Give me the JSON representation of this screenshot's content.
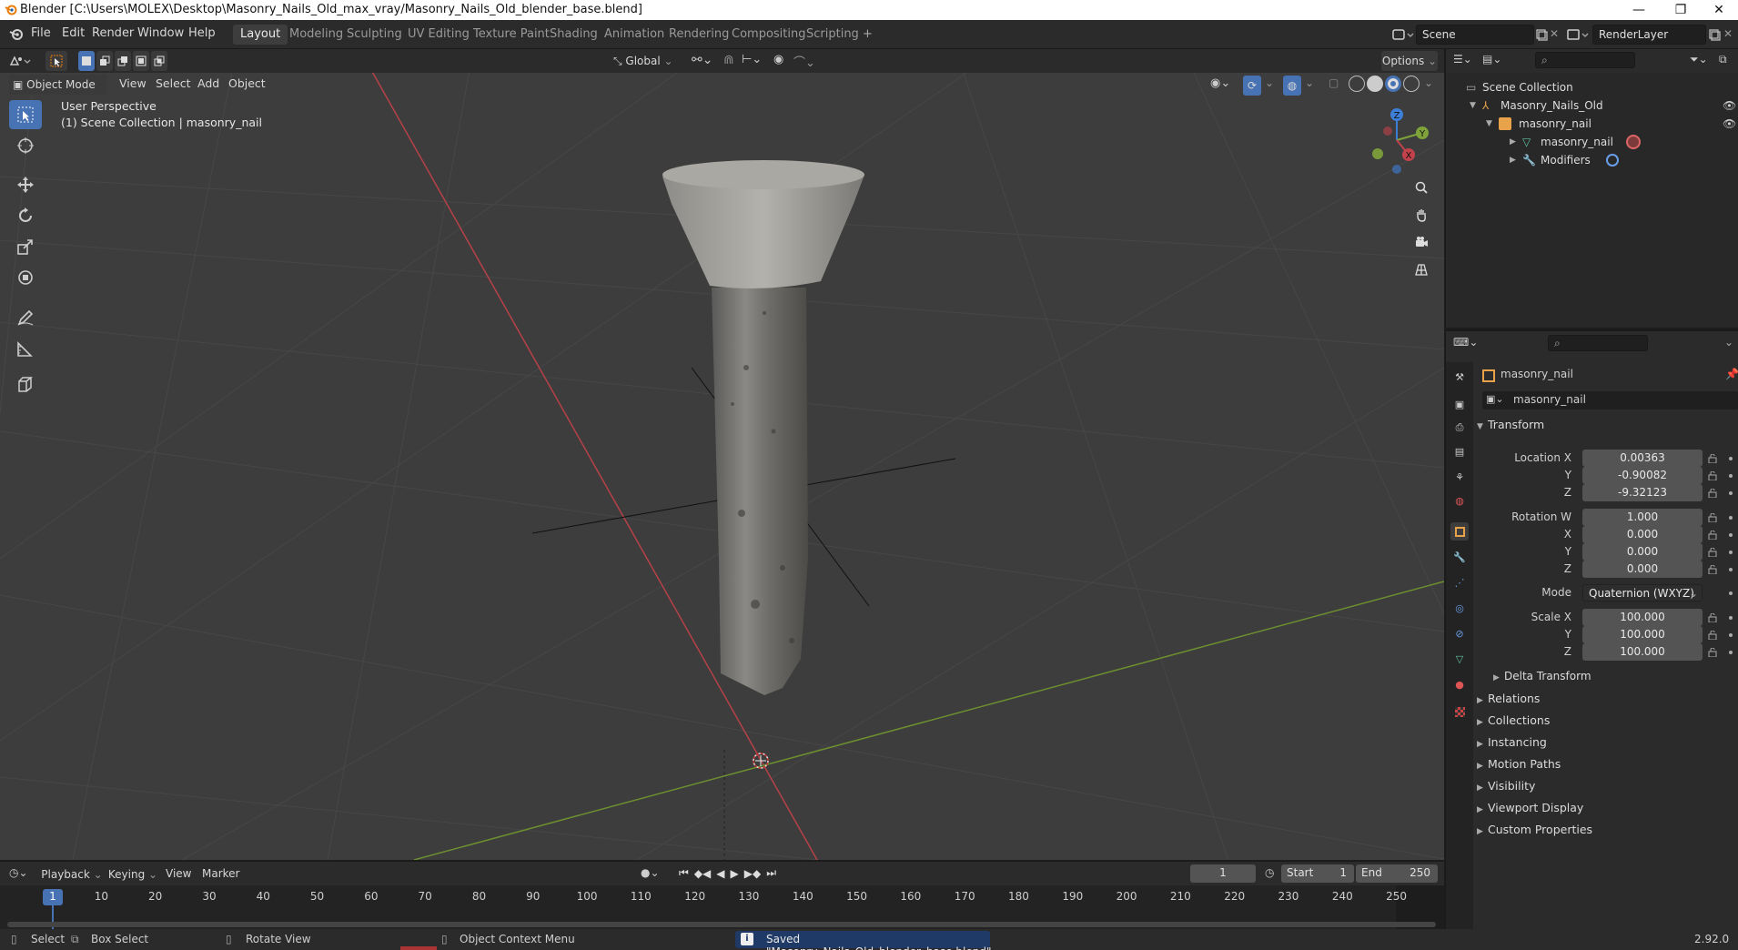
{
  "window": {
    "title": "Blender [C:\\Users\\MOLEX\\Desktop\\Masonry_Nails_Old_max_vray/Masonry_Nails_Old_blender_base.blend]",
    "minimize": "—",
    "restore": "❐",
    "close": "✕"
  },
  "menu": [
    "File",
    "Edit",
    "Render",
    "Window",
    "Help"
  ],
  "workspaces": {
    "tabs": [
      "Layout",
      "Modeling",
      "Sculpting",
      "UV Editing",
      "Texture Paint",
      "Shading",
      "Animation",
      "Rendering",
      "Compositing",
      "Scripting"
    ],
    "active": "Layout",
    "add": "+"
  },
  "scene": {
    "name": "Scene",
    "view_layer": "RenderLayer"
  },
  "viewport": {
    "mode": "Object Mode",
    "menus": [
      "View",
      "Select",
      "Add",
      "Object"
    ],
    "orientation": "Global",
    "options": "Options",
    "perspective": "User Perspective",
    "collection_info": "(1) Scene Collection | masonry_nail",
    "gizmo": {
      "z": "Z",
      "y": "Y",
      "x": "X"
    }
  },
  "outliner": {
    "root": "Scene Collection",
    "items": [
      {
        "label": "Masonry_Nails_Old",
        "depth": 1
      },
      {
        "label": "masonry_nail",
        "depth": 2
      },
      {
        "label": "masonry_nail",
        "depth": 3
      },
      {
        "label": "Modifiers",
        "depth": 3
      }
    ]
  },
  "properties": {
    "object_name": "masonry_nail",
    "data_name": "masonry_nail",
    "transform_label": "Transform",
    "location": {
      "label": "Location X",
      "x": "0.00363",
      "y": "-0.90082",
      "z": "-9.32123"
    },
    "rotation": {
      "label": "Rotation W",
      "w": "1.000",
      "x": "0.000",
      "y": "0.000",
      "z": "0.000"
    },
    "mode": {
      "label": "Mode",
      "value": "Quaternion (WXYZ)"
    },
    "scale": {
      "label": "Scale X",
      "x": "100.000",
      "y": "100.000",
      "z": "100.000"
    },
    "axis_labels": {
      "x": "X",
      "y": "Y",
      "z": "Z"
    },
    "subsection": "Delta Transform",
    "sections": [
      "Relations",
      "Collections",
      "Instancing",
      "Motion Paths",
      "Visibility",
      "Viewport Display",
      "Custom Properties"
    ]
  },
  "timeline": {
    "menus": [
      "Playback",
      "Keying",
      "View",
      "Marker"
    ],
    "current_frame": "1",
    "start_label": "Start",
    "start": "1",
    "end_label": "End",
    "end": "250",
    "ticks": [
      "1",
      "10",
      "20",
      "30",
      "40",
      "50",
      "60",
      "70",
      "80",
      "90",
      "100",
      "110",
      "120",
      "130",
      "140",
      "150",
      "160",
      "170",
      "180",
      "190",
      "200",
      "210",
      "220",
      "230",
      "240",
      "250"
    ]
  },
  "statusbar": {
    "select": "Select",
    "box_select": "Box Select",
    "rotate_view": "Rotate View",
    "context_menu": "Object Context Menu",
    "message": "Saved \"Masonry_Nails_Old_blender_base.blend\"",
    "version": "2.92.0"
  },
  "colors": {
    "accent": "#4772b3",
    "x_axis": "#c2424b",
    "y_axis": "#7fa33a",
    "z_axis": "#3d7fd6"
  }
}
